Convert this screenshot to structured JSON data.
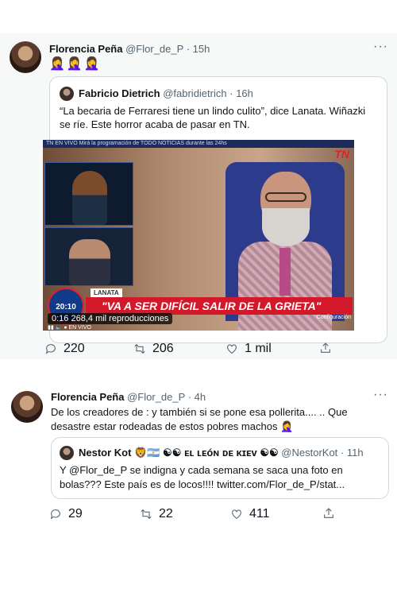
{
  "tweet1": {
    "author_name": "Florencia Peña",
    "handle": "@Flor_de_P",
    "time": "15h",
    "more": "···",
    "emojis": "🤦‍♀️🤦‍♀️🤦‍♀️",
    "quote": {
      "author_name": "Fabricio Dietrich",
      "handle": "@fabridietrich",
      "time": "16h",
      "text": "“La becaria de Ferraresi tiene un lindo culito”, dice Lanata. Wiñazki se ríe. Este horror acaba de pasar en TN.",
      "video": {
        "ticker": "TN EN VIVO  Mirá la programación de TODO NOTICIAS durante las 24hs",
        "channel_logo": "TN",
        "clock": "20:10",
        "name_label": "LANATA",
        "banner": "\"VA A SER DIFÍCIL SALIR DE LA GRIETA\"",
        "config": "Configuración",
        "duration": "0:16",
        "views": "268,4 mil reproducciones",
        "live": "● EN VIVO"
      }
    },
    "actions": {
      "replies": "220",
      "retweets": "206",
      "likes": "1 mil"
    }
  },
  "tweet2": {
    "author_name": "Florencia Peña",
    "handle": "@Flor_de_P",
    "time": "4h",
    "more": "···",
    "text": "De los creadores de : y también si se pone esa pollerita.... .. Que desastre estar rodeadas de estos pobres machos 🤦‍♀️",
    "quote": {
      "author_name": "Nestor Kot 🦁🇦🇷 ☯☯ ᴇʟ ʟᴇóɴ ᴅᴇ ᴋɪᴇᴠ ☯☯",
      "handle": "@NestorKot",
      "time": "11h",
      "text": "Y @Flor_de_P se indigna y cada semana se saca una foto en bolas??? Este país es de locos!!!! twitter.com/Flor_de_P/stat..."
    },
    "actions": {
      "replies": "29",
      "retweets": "22",
      "likes": "411"
    }
  },
  "colors": {
    "muted": "#536471",
    "border": "#cfd9de",
    "banner_red": "#d3182a"
  }
}
